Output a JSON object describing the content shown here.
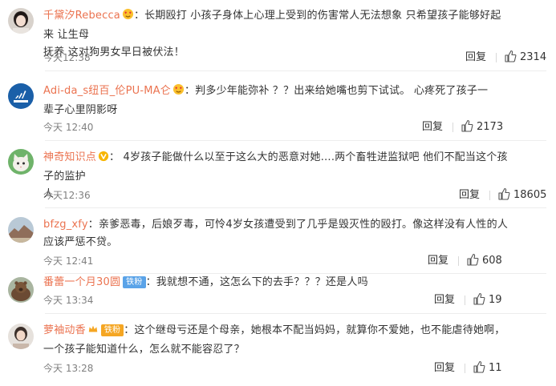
{
  "comments": [
    {
      "username": "千黛汐Rebecca",
      "text": "长期殴打 小孩子身体上心理上受到的伤害常人无法想象 只希望孩子能够好起来 让生母抚养 这对狗男女早日被伏法！",
      "time": "今天12:38",
      "reply_label": "回复",
      "likes": "2314",
      "avatar_icon": "girl-avatar-icon",
      "badge_icon": "heart-eyes-emoji-icon",
      "lines": [
        "：长期殴打 小孩子身体上心理上受到的伤害常人无法想象 只希望孩子能够好起来 让生母",
        "抚养 这对狗男女早日被伏法！"
      ]
    },
    {
      "username": "Adi-da_s纽百_伦PU-MA仑",
      "text": "判多少年能弥补 ？？出来给她嘴也剪下试试。 心疼死了孩子一辈子心里阴影呀",
      "time": "今天 12:40",
      "reply_label": "回复",
      "likes": "2173",
      "avatar_icon": "adidas-logo-avatar-icon",
      "badge_icon": "heart-eyes-emoji-icon",
      "lines": [
        "：判多少年能弥补 ？？出来给她嘴也剪下试试。   心疼死了孩子一",
        "辈子心里阴影呀"
      ]
    },
    {
      "username": "神奇知识点",
      "text": "4岁孩子能做什么以至于这么大的恶意对她….两个畜牲进监狱吧 他们不配当这个孩子的监护人",
      "time": "今天12:36",
      "reply_label": "回复",
      "likes": "18605",
      "avatar_icon": "cat-avatar-icon",
      "badge_icon": "verified-v-icon",
      "lines": [
        "：  4岁孩子能做什么以至于这么大的恶意对她….两个畜牲进监狱吧 他们不配当这个孩子的监护",
        "人"
      ]
    },
    {
      "username": "bfzg_xfy",
      "text": "亲爹恶毒，后娘歹毒，可怜4岁女孩遭受到了几乎是毁灭性的殴打。像这样没有人性的人应该严惩不贷。",
      "time": "今天 12:41",
      "reply_label": "回复",
      "likes": "608",
      "avatar_icon": "landscape-avatar-icon",
      "lines": [
        "：亲爹恶毒，后娘歹毒，可怜4岁女孩遭受到了几乎是毁灭性的殴打。像这样没有人性的人",
        "应该严惩不贷。"
      ]
    },
    {
      "username": "番蕾一个月30圆",
      "text": "我就想不通，这怎么下的去手？？？还是人吗",
      "time": "今天 13:34",
      "reply_label": "回复",
      "likes": "19",
      "avatar_icon": "bear-avatar-icon",
      "tag": "铁粉",
      "tag_color": "#5aa3e8",
      "lines": [
        "：我就想不通，这怎么下的去手？？？还是人吗"
      ]
    },
    {
      "username": "萝袖动香",
      "text": "这个继母亏还是个母亲，她根本不配当妈妈，就算你不爱她，也不能虐待她啊，一个孩子能知道什么，怎么就不能容忍了？",
      "time": "今天 13:28",
      "reply_label": "回复",
      "likes": "11",
      "avatar_icon": "portrait-avatar-icon",
      "badge_icon": "crown-icon",
      "tag": "铁粉",
      "tag_color": "#f5a623",
      "lines": [
        "：这个继母亏还是个母亲，她根本不配当妈妈，就算你不爱她，也不能虐待她啊，",
        "一个孩子能知道什么，怎么就不能容忍了？"
      ]
    }
  ],
  "colors": {
    "username": "#eb7350",
    "text": "#333333",
    "meta": "#808080"
  }
}
